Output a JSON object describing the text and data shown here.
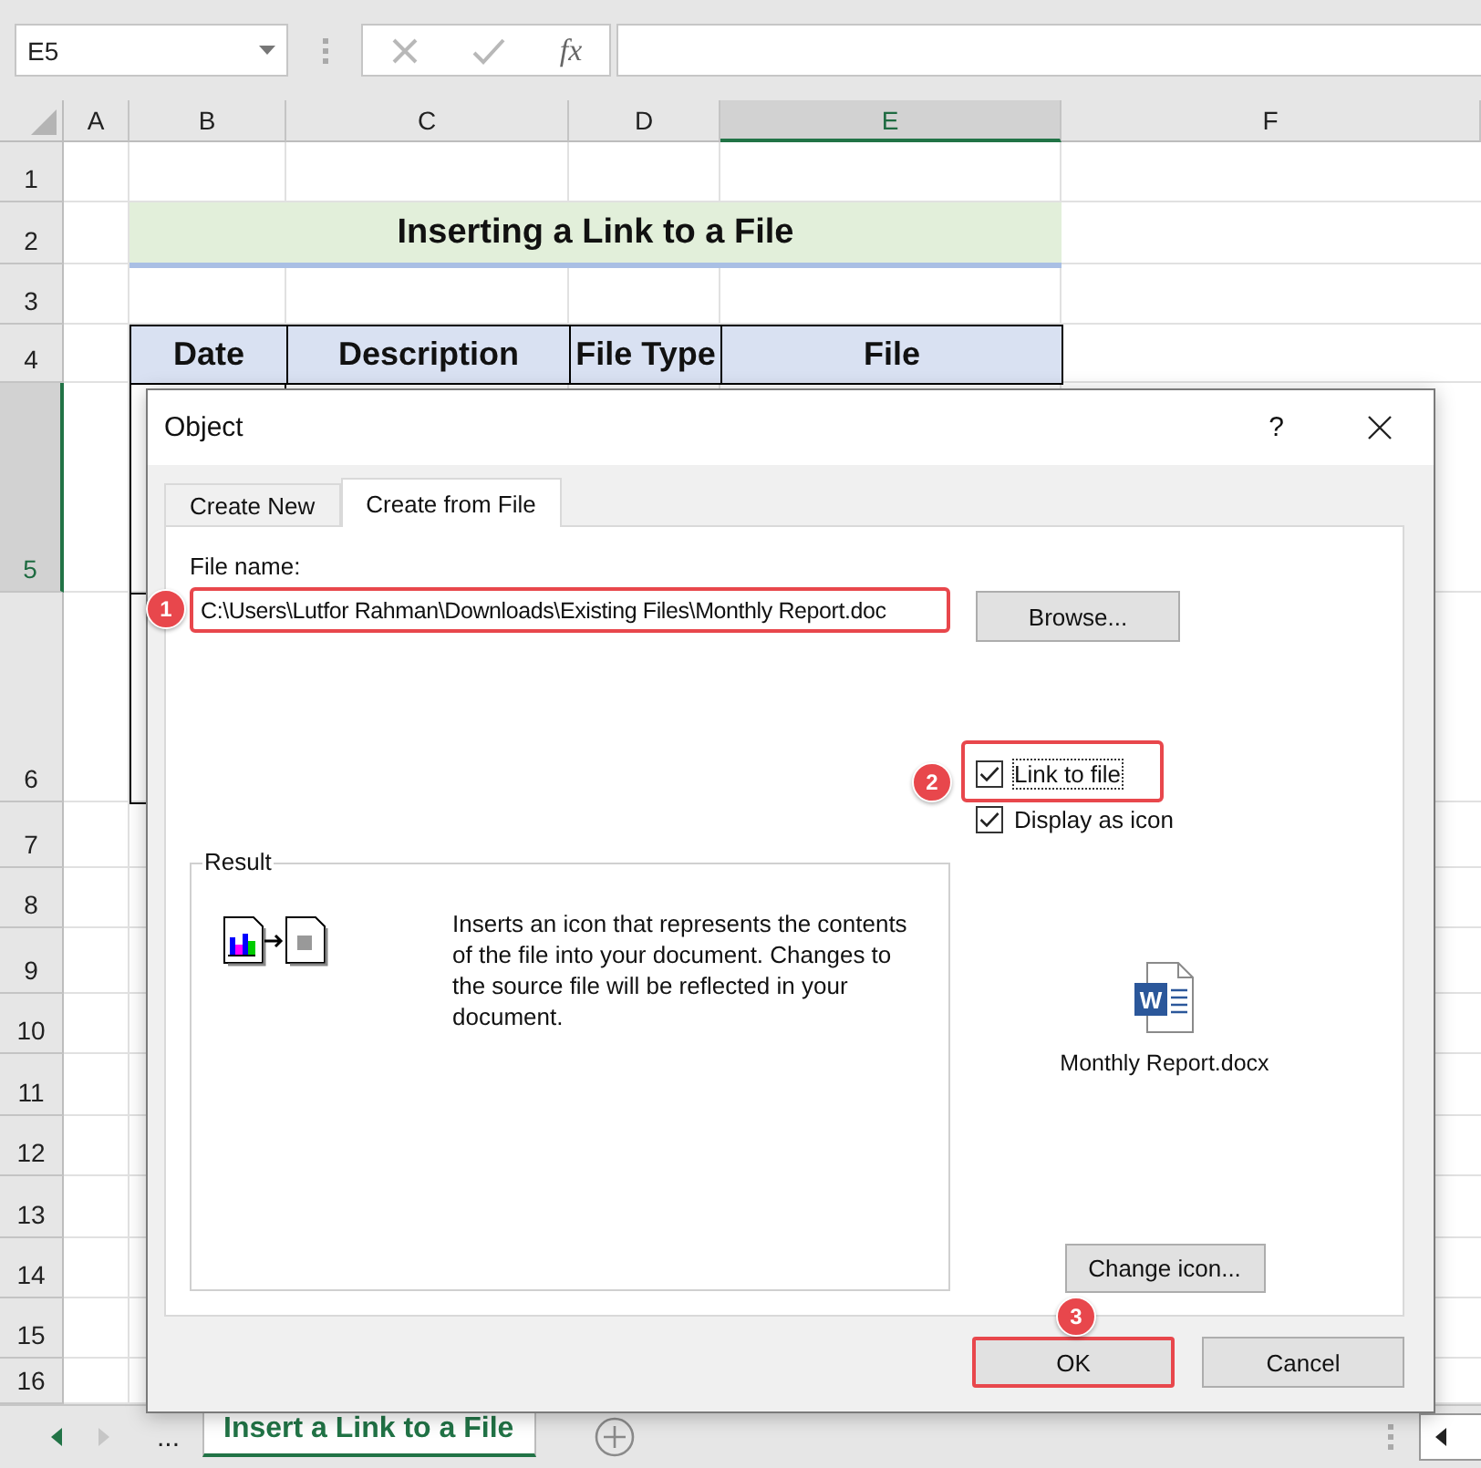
{
  "name_box": {
    "value": "E5"
  },
  "formula_bar": {
    "function_label": "fx"
  },
  "columns": [
    {
      "label": "A",
      "selected": false
    },
    {
      "label": "B",
      "selected": false
    },
    {
      "label": "C",
      "selected": false
    },
    {
      "label": "D",
      "selected": false
    },
    {
      "label": "E",
      "selected": true
    },
    {
      "label": "F",
      "selected": false
    }
  ],
  "rows": [
    {
      "label": "1",
      "selected": false
    },
    {
      "label": "2",
      "selected": false
    },
    {
      "label": "3",
      "selected": false
    },
    {
      "label": "4",
      "selected": false
    },
    {
      "label": "5",
      "selected": true
    },
    {
      "label": "6",
      "selected": false
    },
    {
      "label": "7",
      "selected": false
    },
    {
      "label": "8",
      "selected": false
    },
    {
      "label": "9",
      "selected": false
    },
    {
      "label": "10",
      "selected": false
    },
    {
      "label": "11",
      "selected": false
    },
    {
      "label": "12",
      "selected": false
    },
    {
      "label": "13",
      "selected": false
    },
    {
      "label": "14",
      "selected": false
    },
    {
      "label": "15",
      "selected": false
    },
    {
      "label": "16",
      "selected": false
    }
  ],
  "sheet": {
    "title": "Inserting a Link to a File",
    "headers": [
      "Date",
      "Description",
      "File Type",
      "File"
    ]
  },
  "dialog": {
    "title": "Object",
    "help": "?",
    "tabs": [
      {
        "label": "Create New",
        "selected": false
      },
      {
        "label": "Create from File",
        "selected": true
      }
    ],
    "file_name": {
      "label": "File name:",
      "value": "C:\\Users\\Lutfor Rahman\\Downloads\\Existing Files\\Monthly Report.doc",
      "callout": "1"
    },
    "browse": "Browse...",
    "options": [
      {
        "label": "Link to file",
        "checked": true,
        "callout": "2"
      },
      {
        "label": "Display as icon",
        "checked": true
      }
    ],
    "result": {
      "label": "Result",
      "text": "Inserts an icon that represents the contents of the file into your document. Changes to the source file will be reflected in your document."
    },
    "file_icon": {
      "badge": "W",
      "caption": "Monthly Report.docx"
    },
    "change_icon": "Change icon...",
    "buttons": [
      {
        "label": "OK",
        "callout": "3"
      },
      {
        "label": "Cancel"
      }
    ]
  },
  "sheet_tabs": {
    "more": "...",
    "tabs": [
      {
        "label": "Insert a Link to a File",
        "selected": true
      }
    ]
  }
}
